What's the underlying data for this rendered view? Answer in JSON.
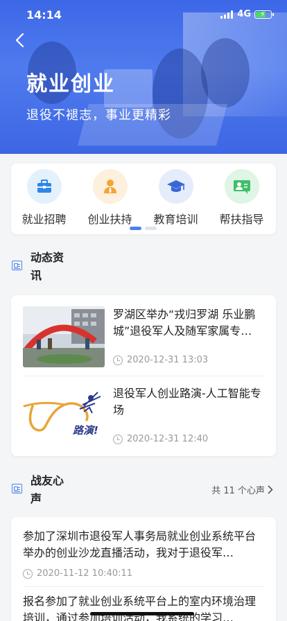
{
  "status": {
    "time": "14:14",
    "network": "4G"
  },
  "hero": {
    "title": "就业创业",
    "subtitle": "退役不褪志，事业更精彩"
  },
  "categories": [
    {
      "label": "就业招聘",
      "icon": "briefcase-icon",
      "bg": "#e3f1fd",
      "color": "#2f86e6"
    },
    {
      "label": "创业扶持",
      "icon": "person-icon",
      "bg": "#fdf0dc",
      "color": "#f2a534"
    },
    {
      "label": "教育培训",
      "icon": "graduation-cap-icon",
      "bg": "#e5ecfb",
      "color": "#3a67d8"
    },
    {
      "label": "帮扶指导",
      "icon": "chat-icon",
      "bg": "#dff5e6",
      "color": "#3fbf6a"
    }
  ],
  "news_section": {
    "title": "动态资讯"
  },
  "news": [
    {
      "title": "罗湖区举办“戎归罗湖 乐业鹏城”退役军人及随军家属专…",
      "time": "2020-12-31 13:03"
    },
    {
      "title": "退役军人创业路演-人工智能专场",
      "time": "2020-12-31 12:40"
    }
  ],
  "voice_section": {
    "title": "战友心声",
    "more": "共 11 个心声"
  },
  "voices": [
    {
      "text": "参加了深圳市退役军人事务局就业创业系统平台举办的创业沙龙直播活动，我对于退役军…",
      "time": "2020-11-12 10:40:11"
    },
    {
      "text": "报名参加了就业创业系统平台上的室内环境治理培训，通过参加培训活动，我系统的学习…",
      "time": ""
    }
  ],
  "colors": {
    "accent": "#4b82f0",
    "hero": "#3c68e8"
  }
}
